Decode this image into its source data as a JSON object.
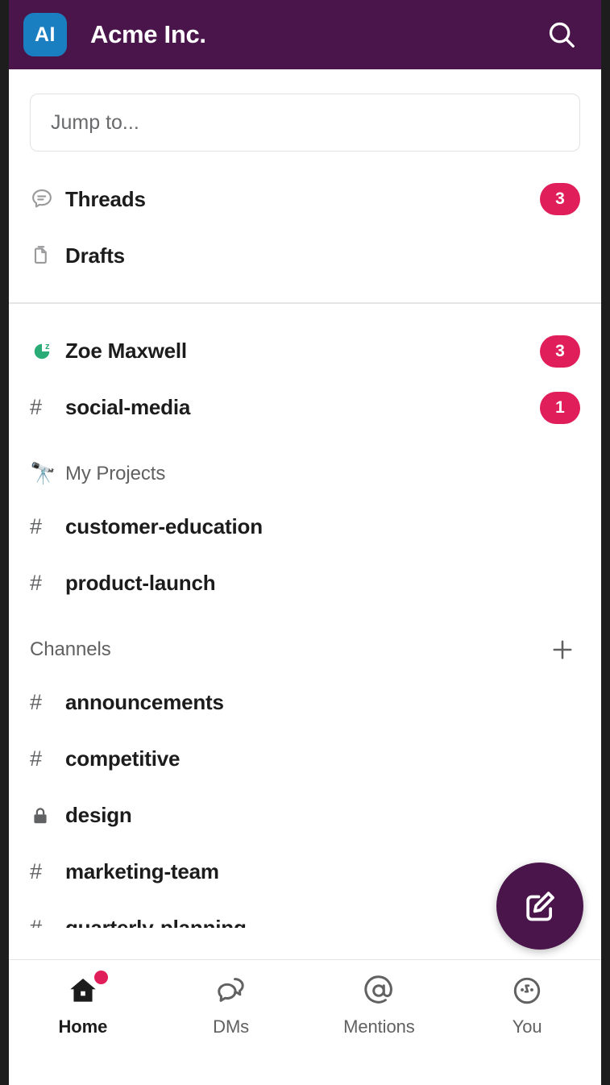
{
  "colors": {
    "header_purple": "#4A154B",
    "badge_crimson": "#E01E5A",
    "workspace_icon_blue": "#1A7FC1",
    "text_primary": "#1D1C1D",
    "text_secondary": "#616162",
    "presence_green": "#2BAC76"
  },
  "header": {
    "workspace_initials": "AI",
    "workspace_icon_name": "workspace-avatar",
    "title": "Acme Inc.",
    "search_icon": "search-icon"
  },
  "search": {
    "placeholder": "Jump to...",
    "value": ""
  },
  "quick_nav": [
    {
      "label": "Threads",
      "icon": "threads-bubble-icon",
      "badge": "3"
    },
    {
      "label": "Drafts",
      "icon": "drafts-pages-icon",
      "badge": ""
    }
  ],
  "recents": [
    {
      "label": "Zoe Maxwell",
      "icon": "presence-away-icon",
      "badge": "3",
      "type": "dm"
    },
    {
      "label": "social-media",
      "icon": "hash-icon",
      "badge": "1",
      "type": "channel"
    }
  ],
  "sections": [
    {
      "title": "My Projects",
      "emoji": "🔭",
      "emoji_name": "telescope-emoji",
      "has_add": false,
      "add_label": "",
      "items": [
        {
          "label": "customer-education",
          "icon": "hash-icon",
          "badge": ""
        },
        {
          "label": "product-launch",
          "icon": "hash-icon",
          "badge": ""
        }
      ]
    },
    {
      "title": "Channels",
      "emoji": "",
      "emoji_name": "",
      "has_add": true,
      "add_label": "+",
      "items": [
        {
          "label": "announcements",
          "icon": "hash-icon",
          "badge": ""
        },
        {
          "label": "competitive",
          "icon": "hash-icon",
          "badge": ""
        },
        {
          "label": "design",
          "icon": "lock-icon",
          "badge": ""
        },
        {
          "label": "marketing-team",
          "icon": "hash-icon",
          "badge": ""
        },
        {
          "label": "quarterly-planning",
          "icon": "hash-icon",
          "badge": ""
        }
      ]
    }
  ],
  "compose": {
    "icon": "compose-pencil-icon",
    "label": ""
  },
  "bottom_nav": [
    {
      "label": "Home",
      "icon": "home-icon",
      "active": true,
      "has_dot": true
    },
    {
      "label": "DMs",
      "icon": "dms-bubbles-icon",
      "active": false,
      "has_dot": false
    },
    {
      "label": "Mentions",
      "icon": "at-mention-icon",
      "active": false,
      "has_dot": false
    },
    {
      "label": "You",
      "icon": "face-avatar-icon",
      "active": false,
      "has_dot": false
    }
  ]
}
